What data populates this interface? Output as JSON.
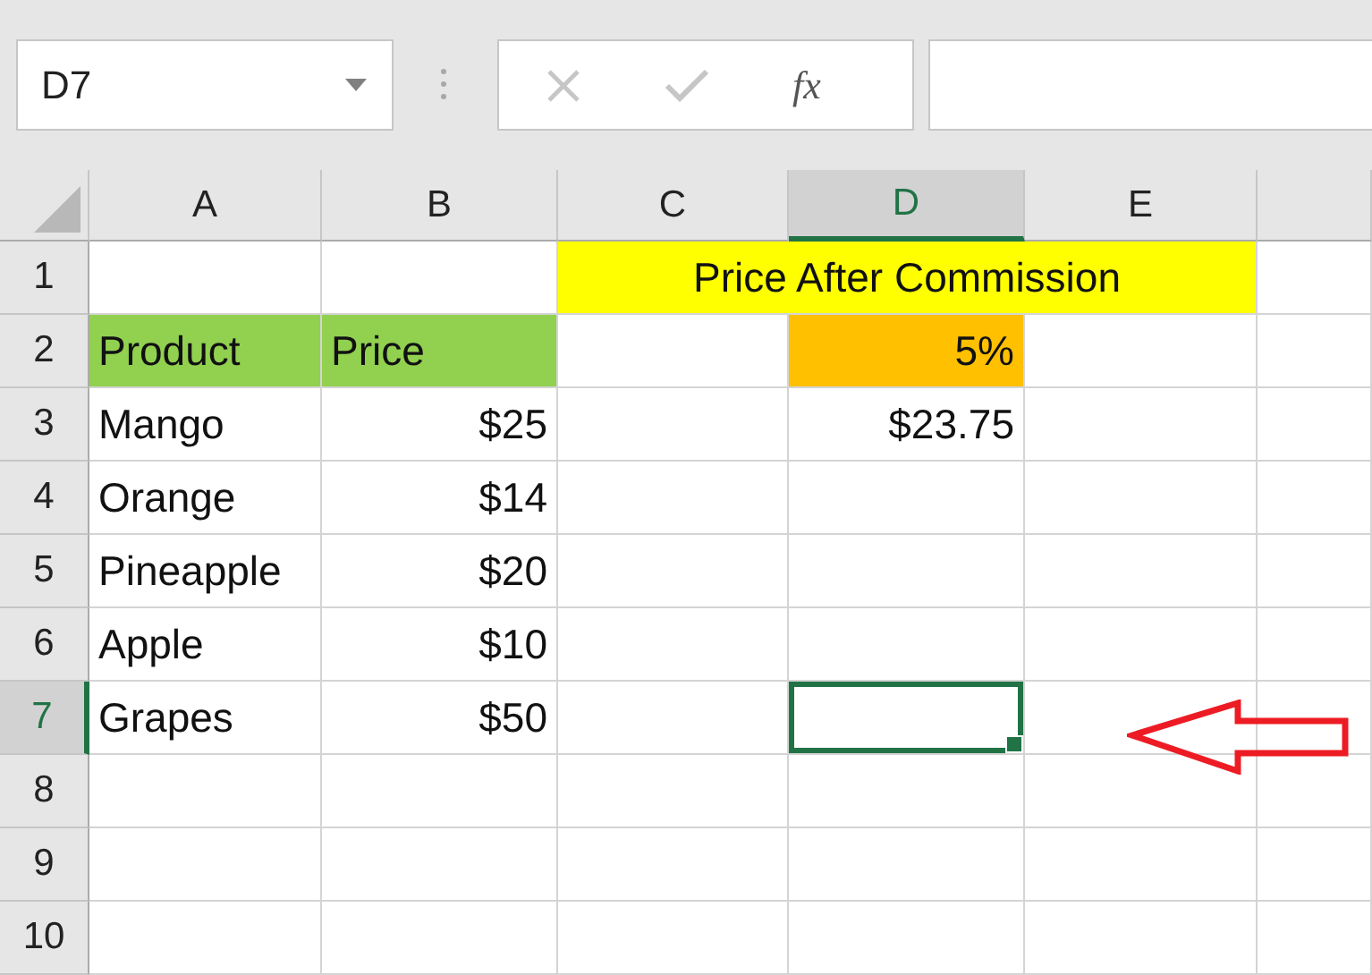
{
  "name_box": {
    "value": "D7"
  },
  "formula_bar": {
    "fx_label": "fx"
  },
  "columns": [
    {
      "label": "A",
      "selected": false
    },
    {
      "label": "B",
      "selected": false
    },
    {
      "label": "C",
      "selected": false
    },
    {
      "label": "D",
      "selected": true
    },
    {
      "label": "E",
      "selected": false
    }
  ],
  "rows": [
    {
      "label": "1",
      "selected": false,
      "cells": [
        {
          "selected": false
        },
        {
          "selected": false
        },
        {
          "kind": "merged",
          "text": "Price After Commission",
          "color": "#ffff00",
          "selected": false
        }
      ]
    },
    {
      "label": "2",
      "selected": false,
      "cells": [
        {
          "kind": "text",
          "text": "Product",
          "color": "#92d050",
          "selected": false
        },
        {
          "kind": "text",
          "text": "Price",
          "color": "#92d050",
          "selected": false
        },
        {
          "selected": false
        },
        {
          "kind": "number",
          "text": "5%",
          "color": "#ffc000",
          "selected": false
        },
        {
          "selected": false
        }
      ]
    },
    {
      "label": "3",
      "selected": false,
      "cells": [
        {
          "kind": "text",
          "text": "Mango",
          "selected": false
        },
        {
          "kind": "number",
          "text": "$25",
          "selected": false
        },
        {
          "selected": false
        },
        {
          "kind": "number",
          "text": "$23.75",
          "selected": false
        },
        {
          "selected": false
        }
      ]
    },
    {
      "label": "4",
      "selected": false,
      "cells": [
        {
          "kind": "text",
          "text": "Orange",
          "selected": false
        },
        {
          "kind": "number",
          "text": "$14",
          "selected": false
        },
        {
          "selected": false
        },
        {
          "selected": false
        },
        {
          "selected": false
        }
      ]
    },
    {
      "label": "5",
      "selected": false,
      "cells": [
        {
          "kind": "text",
          "text": "Pineapple",
          "selected": false
        },
        {
          "kind": "number",
          "text": "$20",
          "selected": false
        },
        {
          "selected": false
        },
        {
          "selected": false
        },
        {
          "selected": false
        }
      ]
    },
    {
      "label": "6",
      "selected": false,
      "cells": [
        {
          "kind": "text",
          "text": "Apple",
          "selected": false
        },
        {
          "kind": "number",
          "text": "$10",
          "selected": false
        },
        {
          "selected": false
        },
        {
          "selected": false
        },
        {
          "selected": false
        }
      ]
    },
    {
      "label": "7",
      "selected": true,
      "cells": [
        {
          "kind": "text",
          "text": "Grapes",
          "selected": false
        },
        {
          "kind": "number",
          "text": "$50",
          "selected": false
        },
        {
          "selected": false
        },
        {
          "selected": true
        },
        {
          "selected": false
        }
      ]
    },
    {
      "label": "8",
      "selected": false,
      "cells": [
        {
          "selected": false
        },
        {
          "selected": false
        },
        {
          "selected": false
        },
        {
          "selected": false
        },
        {
          "selected": false
        }
      ]
    },
    {
      "label": "9",
      "selected": false,
      "cells": [
        {
          "selected": false
        },
        {
          "selected": false
        },
        {
          "selected": false
        },
        {
          "selected": false
        },
        {
          "selected": false
        }
      ]
    },
    {
      "label": "10",
      "selected": false,
      "cells": [
        {
          "selected": false
        },
        {
          "selected": false
        },
        {
          "selected": false
        },
        {
          "selected": false
        },
        {
          "selected": false
        }
      ]
    }
  ]
}
